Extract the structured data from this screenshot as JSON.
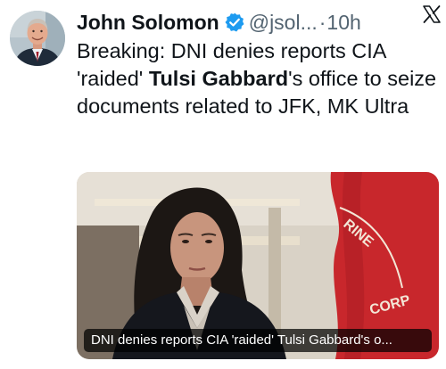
{
  "tweet": {
    "author": {
      "display_name": "John Solomon",
      "handle": "@jsol...",
      "verified": true,
      "avatar_icon": "person-avatar"
    },
    "separator": "·",
    "timestamp": "10h",
    "platform_logo": "x-logo-icon",
    "text": {
      "part1": "Breaking: DNI denies reports CIA 'raided' ",
      "bold": "Tulsi Gabbard",
      "part2": "'s office to seize documents related to JFK, MK Ultra"
    },
    "media": {
      "caption": "DNI denies reports CIA 'raided' Tulsi Gabbard's o..."
    }
  },
  "colors": {
    "text_primary": "#0f1419",
    "text_secondary": "#536471",
    "verified_blue": "#1d9bf0",
    "caption_bg": "rgba(0,0,0,0.72)"
  }
}
